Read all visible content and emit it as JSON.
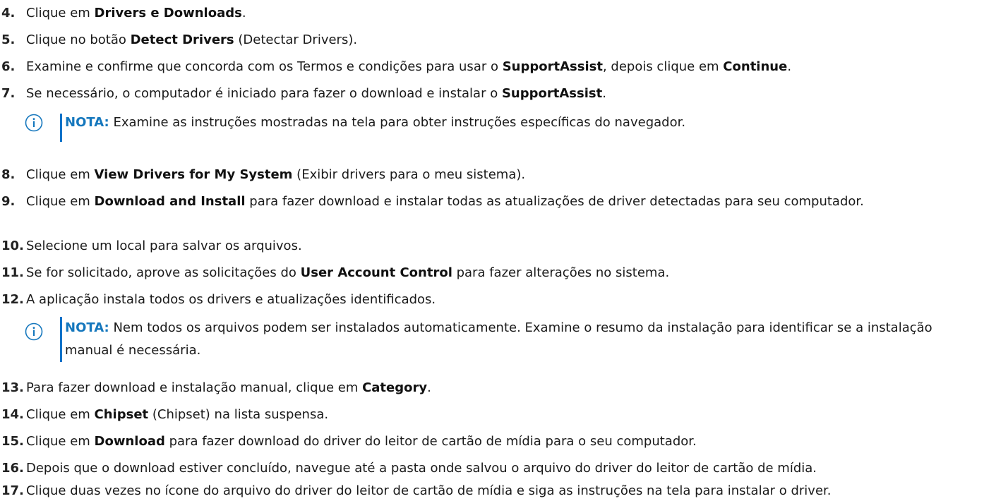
{
  "steps": [
    {
      "n": "4.",
      "a": "Clique em ",
      "b": "Drivers e Downloads",
      "c": "."
    },
    {
      "n": "5.",
      "a": "Clique no botão ",
      "b": "Detect Drivers",
      "c": " (Detectar Drivers)."
    },
    {
      "n": "6.",
      "a": "Examine e confirme que concorda com os Termos e condições para usar o ",
      "b": "SupportAssist",
      "c": ", depois clique em ",
      "d": "Continue",
      "e": "."
    },
    {
      "n": "7.",
      "a": "Se necessário, o computador é iniciado para fazer o download e instalar o ",
      "b": "SupportAssist",
      "c": "."
    },
    {
      "n": "8.",
      "a": "Clique em ",
      "b": "View Drivers for My System",
      "c": " (Exibir drivers para o meu sistema)."
    },
    {
      "n": "9.",
      "a": "Clique em ",
      "b": "Download and Install",
      "c": " para fazer download e instalar todas as atualizações de driver detectadas para seu computador."
    },
    {
      "n": "10.",
      "a": "Selecione um local para salvar os arquivos."
    },
    {
      "n": "11.",
      "a": "Se for solicitado, aprove as solicitações do ",
      "b": "User Account Control",
      "c": " para fazer alterações no sistema."
    },
    {
      "n": "12.",
      "a": "A aplicação instala todos os drivers e atualizações identificados."
    },
    {
      "n": "13.",
      "a": "Para fazer download e instalação manual, clique em ",
      "b": "Category",
      "c": "."
    },
    {
      "n": "14.",
      "a": "Clique em ",
      "b": "Chipset",
      "c": " (Chipset) na lista suspensa."
    },
    {
      "n": "15.",
      "a": "Clique em ",
      "b": "Download",
      "c": " para fazer download do driver do leitor de cartão de mídia para o seu computador."
    },
    {
      "n": "16.",
      "a": "Depois que o download estiver concluído, navegue até a pasta onde salvou o arquivo do driver do leitor de cartão de mídia."
    },
    {
      "n": "17.",
      "a": "Clique duas vezes no ícone do arquivo do driver do leitor de cartão de mídia e siga as instruções na tela para instalar o driver."
    }
  ],
  "notes": [
    {
      "label": "NOTA:",
      "text": " Examine as instruções mostradas na tela para obter instruções específicas do navegador."
    },
    {
      "label": "NOTA:",
      "text": " Nem todos os arquivos podem ser instalados automaticamente. Examine o resumo da instalação para identificar se a instalação manual é necessária."
    }
  ],
  "colors": {
    "note_accent": "#1577bd",
    "text": "#1a1a1a"
  },
  "icons": {
    "note": "info-circle-icon"
  }
}
